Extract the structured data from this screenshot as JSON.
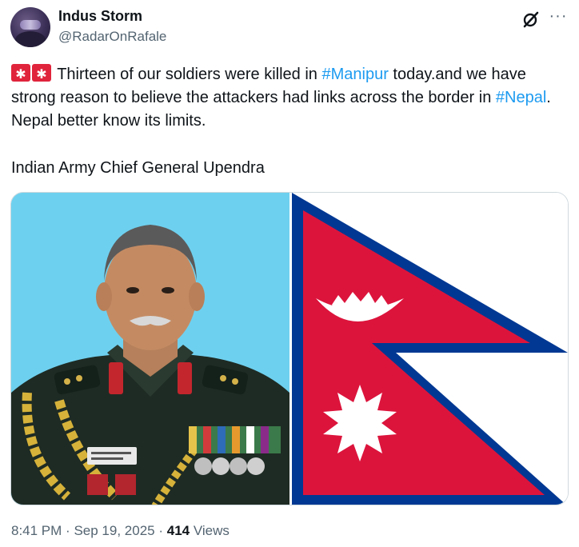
{
  "author": {
    "name": "Indus Storm",
    "handle": "@RadarOnRafale"
  },
  "header_icons": [
    "grok-icon",
    "more-options-icon"
  ],
  "tweet": {
    "emoji": [
      "police-car-light-emoji",
      "police-car-light-emoji"
    ],
    "text_1": "Thirteen of our soldiers were killed in ",
    "hashtag_1": "#Manipur",
    "text_2": " today.and we have strong reason to believe the attackers had links across the border in ",
    "hashtag_2": "#Nepal",
    "text_3": ". Nepal better know its limits.",
    "signature": "Indian Army Chief General Upendra"
  },
  "media": {
    "images": [
      {
        "description_name": "army-officer-photo",
        "background": "#6ed0ef"
      },
      {
        "description_name": "nepal-flag",
        "colors": {
          "crimson": "#dc143c",
          "blue": "#003893",
          "white": "#ffffff"
        }
      }
    ]
  },
  "footer": {
    "time": "8:41 PM",
    "separator": "·",
    "date": "Sep 19, 2025",
    "views_count": "414",
    "views_label": "Views"
  },
  "colors": {
    "link": "#1d9bf0",
    "secondary_text": "#536471",
    "primary_text": "#0f1419",
    "border": "#cfd9de"
  }
}
